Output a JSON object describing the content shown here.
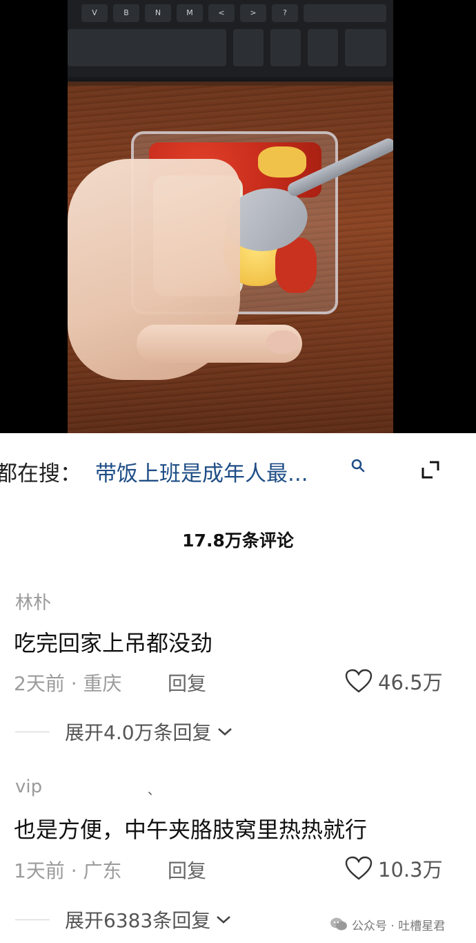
{
  "search": {
    "prefix": "都在搜：",
    "query": "带饭上班是成年人最..."
  },
  "comments_header": "17.8万条评论",
  "comments": [
    {
      "user": "林朴",
      "text": "吃完回家上吊都没劲",
      "meta": "2天前 · 重庆",
      "reply": "回复",
      "likes": "46.5万",
      "expand": "展开4.0万条回复"
    },
    {
      "user": "vip",
      "mark": "、",
      "text": "也是方便，中午夹胳肢窝里热热就行",
      "meta": "1天前 · 广东",
      "reply": "回复",
      "likes": "10.3万",
      "expand": "展开6383条回复"
    }
  ],
  "watermark": {
    "text": "公众号 · 吐槽星君",
    "icon": "wechat-icon"
  },
  "keyboard_keys": [
    "V",
    "B",
    "N",
    "M",
    "<",
    ">",
    "?"
  ],
  "colors": {
    "link": "#1f4e86",
    "muted": "#9b9b9b"
  }
}
